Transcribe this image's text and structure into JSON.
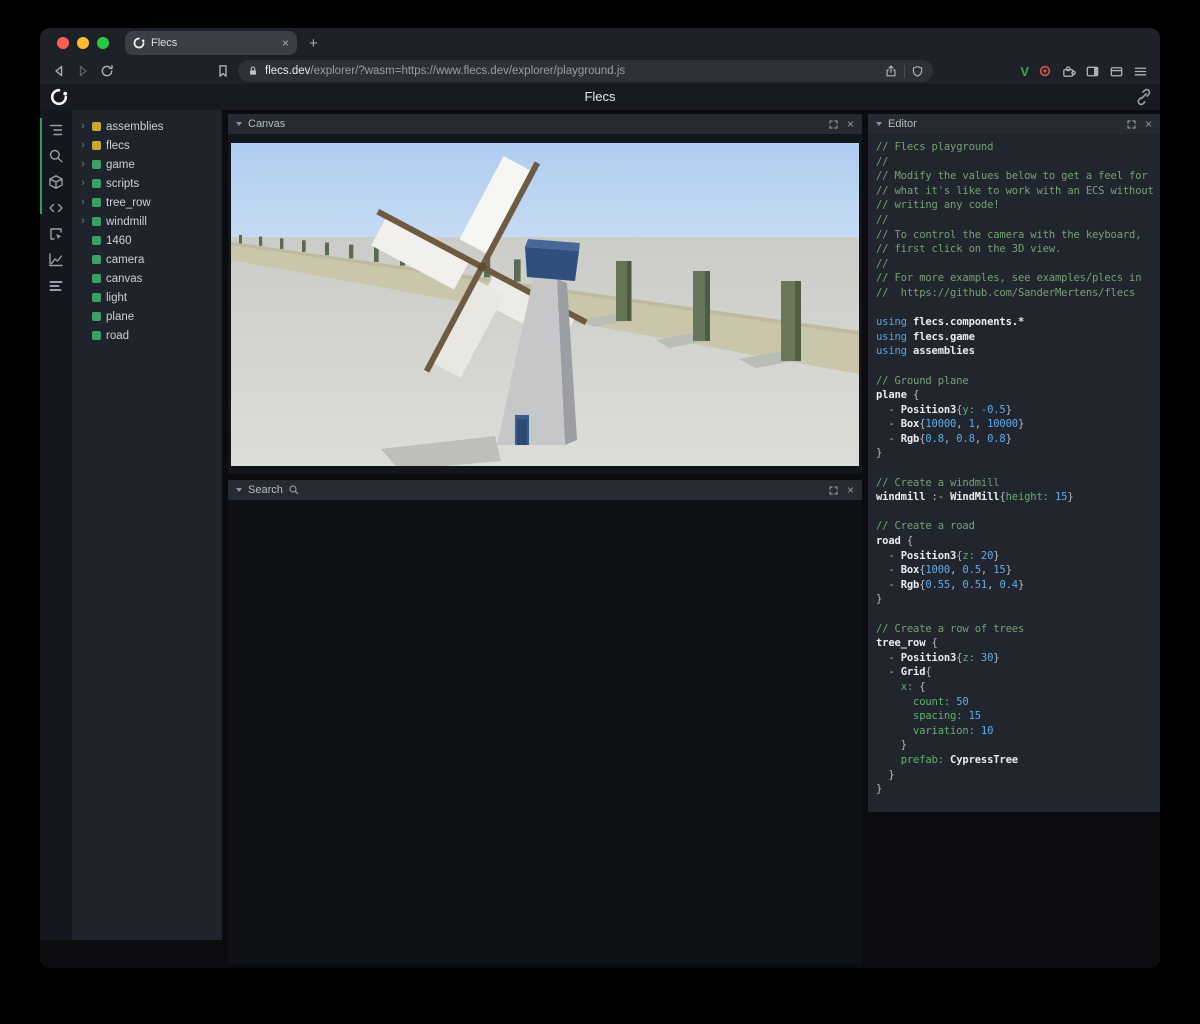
{
  "browser": {
    "traffic_lights": [
      "#ff5f57",
      "#febc2e",
      "#28c840"
    ],
    "tab_title": "Flecs",
    "url_domain": "flecs.dev",
    "url_path": "/explorer/?wasm=https://www.flecs.dev/explorer/playground.js",
    "extension_badge": "V"
  },
  "glyphs": {
    "close": "×",
    "new_tab": "+",
    "tree_chevron": "›"
  },
  "header": {
    "title": "Flecs"
  },
  "panels": {
    "canvas": {
      "title": "Canvas"
    },
    "search": {
      "title": "Search"
    },
    "editor": {
      "title": "Editor"
    }
  },
  "colors": {
    "module_yellow": "#c8a72e",
    "entity_green": "#3ba065",
    "accent_green": "#2f9e63"
  },
  "tree": {
    "items": [
      {
        "label": "assemblies",
        "color": "#c8a72e",
        "expandable": true
      },
      {
        "label": "flecs",
        "color": "#c8a72e",
        "expandable": true
      },
      {
        "label": "game",
        "color": "#3ba065",
        "expandable": true
      },
      {
        "label": "scripts",
        "color": "#3ba065",
        "expandable": true
      },
      {
        "label": "tree_row",
        "color": "#3ba065",
        "expandable": true
      },
      {
        "label": "windmill",
        "color": "#3ba065",
        "expandable": true
      },
      {
        "label": "1460",
        "color": "#3ba065",
        "expandable": false
      },
      {
        "label": "camera",
        "color": "#3ba065",
        "expandable": false
      },
      {
        "label": "canvas",
        "color": "#3ba065",
        "expandable": false
      },
      {
        "label": "light",
        "color": "#3ba065",
        "expandable": false
      },
      {
        "label": "plane",
        "color": "#3ba065",
        "expandable": false
      },
      {
        "label": "road",
        "color": "#3ba065",
        "expandable": false
      }
    ]
  },
  "editor": {
    "lines": [
      [
        [
          "c",
          "// Flecs playground"
        ]
      ],
      [
        [
          "c",
          "//"
        ]
      ],
      [
        [
          "c",
          "// Modify the values below to get a feel for"
        ]
      ],
      [
        [
          "c",
          "// what it's like to work with an ECS without"
        ]
      ],
      [
        [
          "c",
          "// writing any code!"
        ]
      ],
      [
        [
          "c",
          "//"
        ]
      ],
      [
        [
          "c",
          "// To control the camera with the keyboard,"
        ]
      ],
      [
        [
          "c",
          "// first click on the 3D view."
        ]
      ],
      [
        [
          "c",
          "//"
        ]
      ],
      [
        [
          "c",
          "// For more examples, see examples/plecs in"
        ]
      ],
      [
        [
          "c",
          "//  https://github.com/SanderMertens/flecs"
        ]
      ],
      [],
      [
        [
          "k",
          "using "
        ],
        [
          "b",
          "flecs.components.*"
        ]
      ],
      [
        [
          "k",
          "using "
        ],
        [
          "b",
          "flecs.game"
        ]
      ],
      [
        [
          "k",
          "using "
        ],
        [
          "b",
          "assemblies"
        ]
      ],
      [],
      [
        [
          "c",
          "// Ground plane"
        ]
      ],
      [
        [
          "b",
          "plane"
        ],
        [
          "t",
          " {"
        ]
      ],
      [
        [
          "t",
          "  - "
        ],
        [
          "b",
          "Position3"
        ],
        [
          "t",
          "{"
        ],
        [
          "p",
          "y:"
        ],
        [
          "n",
          " -0.5"
        ],
        [
          "t",
          "}"
        ]
      ],
      [
        [
          "t",
          "  - "
        ],
        [
          "b",
          "Box"
        ],
        [
          "t",
          "{"
        ],
        [
          "n",
          "10000"
        ],
        [
          "t",
          ", "
        ],
        [
          "n",
          "1"
        ],
        [
          "t",
          ", "
        ],
        [
          "n",
          "10000"
        ],
        [
          "t",
          "}"
        ]
      ],
      [
        [
          "t",
          "  - "
        ],
        [
          "b",
          "Rgb"
        ],
        [
          "t",
          "{"
        ],
        [
          "n",
          "0.8"
        ],
        [
          "t",
          ", "
        ],
        [
          "n",
          "0.8"
        ],
        [
          "t",
          ", "
        ],
        [
          "n",
          "0.8"
        ],
        [
          "t",
          "}"
        ]
      ],
      [
        [
          "t",
          "}"
        ]
      ],
      [],
      [
        [
          "c",
          "// Create a windmill"
        ]
      ],
      [
        [
          "b",
          "windmill"
        ],
        [
          "t",
          " :- "
        ],
        [
          "b",
          "WindMill"
        ],
        [
          "t",
          "{"
        ],
        [
          "p",
          "height:"
        ],
        [
          "n",
          " 15"
        ],
        [
          "t",
          "}"
        ]
      ],
      [],
      [
        [
          "c",
          "// Create a road"
        ]
      ],
      [
        [
          "b",
          "road"
        ],
        [
          "t",
          " {"
        ]
      ],
      [
        [
          "t",
          "  - "
        ],
        [
          "b",
          "Position3"
        ],
        [
          "t",
          "{"
        ],
        [
          "p",
          "z:"
        ],
        [
          "n",
          " 20"
        ],
        [
          "t",
          "}"
        ]
      ],
      [
        [
          "t",
          "  - "
        ],
        [
          "b",
          "Box"
        ],
        [
          "t",
          "{"
        ],
        [
          "n",
          "1000"
        ],
        [
          "t",
          ", "
        ],
        [
          "n",
          "0.5"
        ],
        [
          "t",
          ", "
        ],
        [
          "n",
          "15"
        ],
        [
          "t",
          "}"
        ]
      ],
      [
        [
          "t",
          "  - "
        ],
        [
          "b",
          "Rgb"
        ],
        [
          "t",
          "{"
        ],
        [
          "n",
          "0.55"
        ],
        [
          "t",
          ", "
        ],
        [
          "n",
          "0.51"
        ],
        [
          "t",
          ", "
        ],
        [
          "n",
          "0.4"
        ],
        [
          "t",
          "}"
        ]
      ],
      [
        [
          "t",
          "}"
        ]
      ],
      [],
      [
        [
          "c",
          "// Create a row of trees"
        ]
      ],
      [
        [
          "b",
          "tree_row"
        ],
        [
          "t",
          " {"
        ]
      ],
      [
        [
          "t",
          "  - "
        ],
        [
          "b",
          "Position3"
        ],
        [
          "t",
          "{"
        ],
        [
          "p",
          "z:"
        ],
        [
          "n",
          " 30"
        ],
        [
          "t",
          "}"
        ]
      ],
      [
        [
          "t",
          "  - "
        ],
        [
          "b",
          "Grid"
        ],
        [
          "t",
          "{"
        ]
      ],
      [
        [
          "t",
          "    "
        ],
        [
          "p",
          "x:"
        ],
        [
          "t",
          " {"
        ]
      ],
      [
        [
          "t",
          "      "
        ],
        [
          "p",
          "count:"
        ],
        [
          "n",
          " 50"
        ]
      ],
      [
        [
          "t",
          "      "
        ],
        [
          "p",
          "spacing:"
        ],
        [
          "n",
          " 15"
        ]
      ],
      [
        [
          "t",
          "      "
        ],
        [
          "p",
          "variation:"
        ],
        [
          "n",
          " 10"
        ]
      ],
      [
        [
          "t",
          "    }"
        ]
      ],
      [
        [
          "t",
          "    "
        ],
        [
          "p",
          "prefab:"
        ],
        [
          "b",
          " CypressTree"
        ]
      ],
      [
        [
          "t",
          "  }"
        ]
      ],
      [
        [
          "t",
          "}"
        ]
      ]
    ]
  }
}
